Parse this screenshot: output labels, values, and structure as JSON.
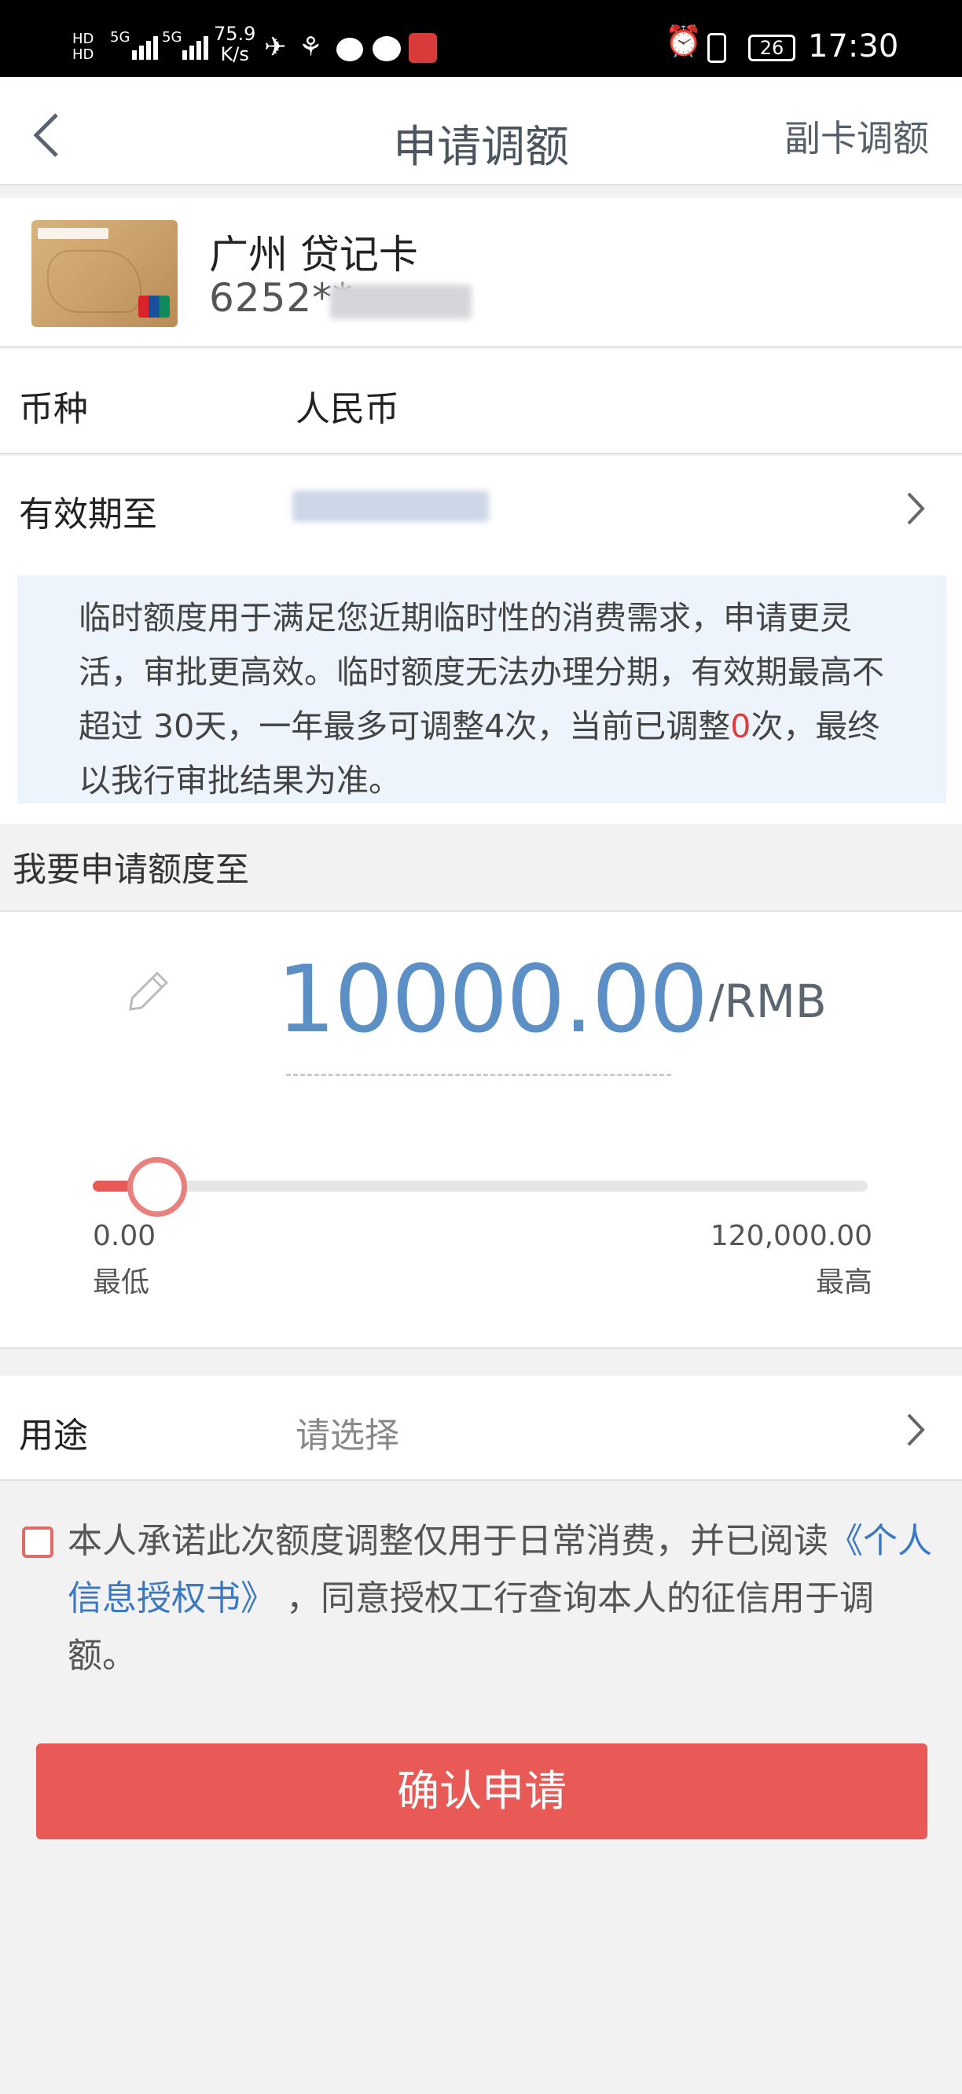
{
  "status_bar": {
    "net_speed": "75.9",
    "net_unit": "K/s",
    "signal1": "5G",
    "signal2": "5G",
    "battery": "26",
    "time": "17:30"
  },
  "nav": {
    "title": "申请调额",
    "right_action": "副卡调额"
  },
  "card": {
    "name": "广州  贷记卡",
    "number": "6252**"
  },
  "currency": {
    "label": "币种",
    "value": "人民币"
  },
  "expiry": {
    "label": "有效期至"
  },
  "notice": {
    "text_before": "临时额度用于满足您近期临时性的消费需求，申请更灵活，审批更高效。临时额度无法办理分期，有效期最高不超过 30天，一年最多可调整4次，当前已调整",
    "count": "0",
    "text_after": "次，最终以我行审批结果为准。"
  },
  "amount": {
    "section_title": "我要申请额度至",
    "value": "10000.00",
    "unit": "/RMB",
    "min_value": "0.00",
    "min_label": "最低",
    "max_value": "120,000.00",
    "max_label": "最高",
    "slider_fraction": 0.083
  },
  "purpose": {
    "label": "用途",
    "placeholder": "请选择"
  },
  "agreement": {
    "text_before": "本人承诺此次额度调整仅用于日常消费，并已阅读",
    "link": "《个人信息授权书》",
    "text_after": " ，同意授权工行查询本人的征信用于调额。",
    "checked": false
  },
  "confirm_button": "确认申请",
  "colors": {
    "accent": "#e95a57",
    "amount": "#5b8fc5",
    "link": "#3a78c4",
    "notice_bg": "#eef4fc"
  }
}
